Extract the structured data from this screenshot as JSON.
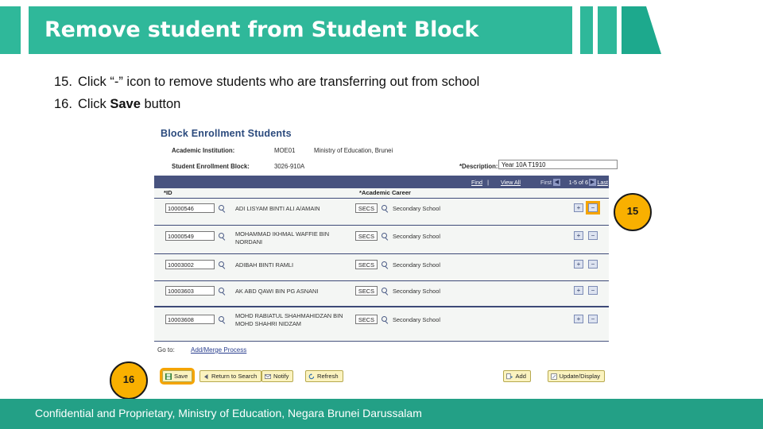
{
  "header": {
    "title": "Remove student from Student Block",
    "bar_color": "#2fb89a",
    "accent_color": "#1da98d"
  },
  "steps": [
    {
      "number": "15.",
      "text": "Click “-” icon to remove students who are transferring out from school",
      "bold_word": ""
    },
    {
      "number": "16.",
      "text_before": "Click ",
      "bold_word": "Save",
      "text_after": " button"
    }
  ],
  "screenshot": {
    "title": "Block Enrollment Students",
    "form": {
      "institution_label": "Academic Institution:",
      "institution_code": "MOE01",
      "institution_name": "Ministry of Education, Brunei",
      "block_label": "Student Enrollment Block:",
      "block_code": "3026-910A",
      "description_label": "*Description:",
      "description_value": "Year 10A T1910"
    },
    "grid_bar": {
      "find": "Find",
      "separator": "|",
      "view_all": "View All",
      "first": "First",
      "prev_icon": "◀",
      "range": "1-5 of 6",
      "next_icon": "▶",
      "last": "Last"
    },
    "columns": {
      "id": "*ID",
      "career": "*Academic Career"
    },
    "rows": [
      {
        "id": "10000546",
        "name": "ADI LISYAM BINTI ALI A/AMAIN",
        "career_code": "SECS",
        "career_desc": "Secondary School",
        "add_label": "+",
        "remove_label": "−",
        "remove_highlighted": true
      },
      {
        "id": "10000549",
        "name": "MOHAMMAD IKHMAL WAFFIE BIN NORDANI",
        "career_code": "SECS",
        "career_desc": "Secondary School",
        "add_label": "+",
        "remove_label": "−",
        "remove_highlighted": false
      },
      {
        "id": "10003002",
        "name": "ADIBAH BINTI RAMLI",
        "career_code": "SECS",
        "career_desc": "Secondary School",
        "add_label": "+",
        "remove_label": "−",
        "remove_highlighted": false
      },
      {
        "id": "10003603",
        "name": "AK ABD QAWI BIN PG ASNANI",
        "career_code": "SECS",
        "career_desc": "Secondary School",
        "add_label": "+",
        "remove_label": "−",
        "remove_highlighted": false
      },
      {
        "id": "10003608",
        "name": "MOHD RABIATUL SHAHMAHIDZAN BIN MOHD SHAHRI NIDZAM",
        "career_code": "SECS",
        "career_desc": "Secondary School",
        "add_label": "+",
        "remove_label": "−",
        "remove_highlighted": false
      }
    ],
    "goto": {
      "label": "Go to:",
      "link": "Add/Merge Process"
    },
    "buttons": {
      "save": "Save",
      "return_to_search": "Return to Search",
      "notify": "Notify",
      "refresh": "Refresh",
      "add": "Add",
      "update_display": "Update/Display"
    }
  },
  "callouts": {
    "badge_top": "15",
    "badge_bottom": "16",
    "badge_color": "#f9b000"
  },
  "footer": {
    "text": "Confidential and Proprietary, Ministry of Education, Negara Brunei Darussalam",
    "color": "#23a086"
  }
}
